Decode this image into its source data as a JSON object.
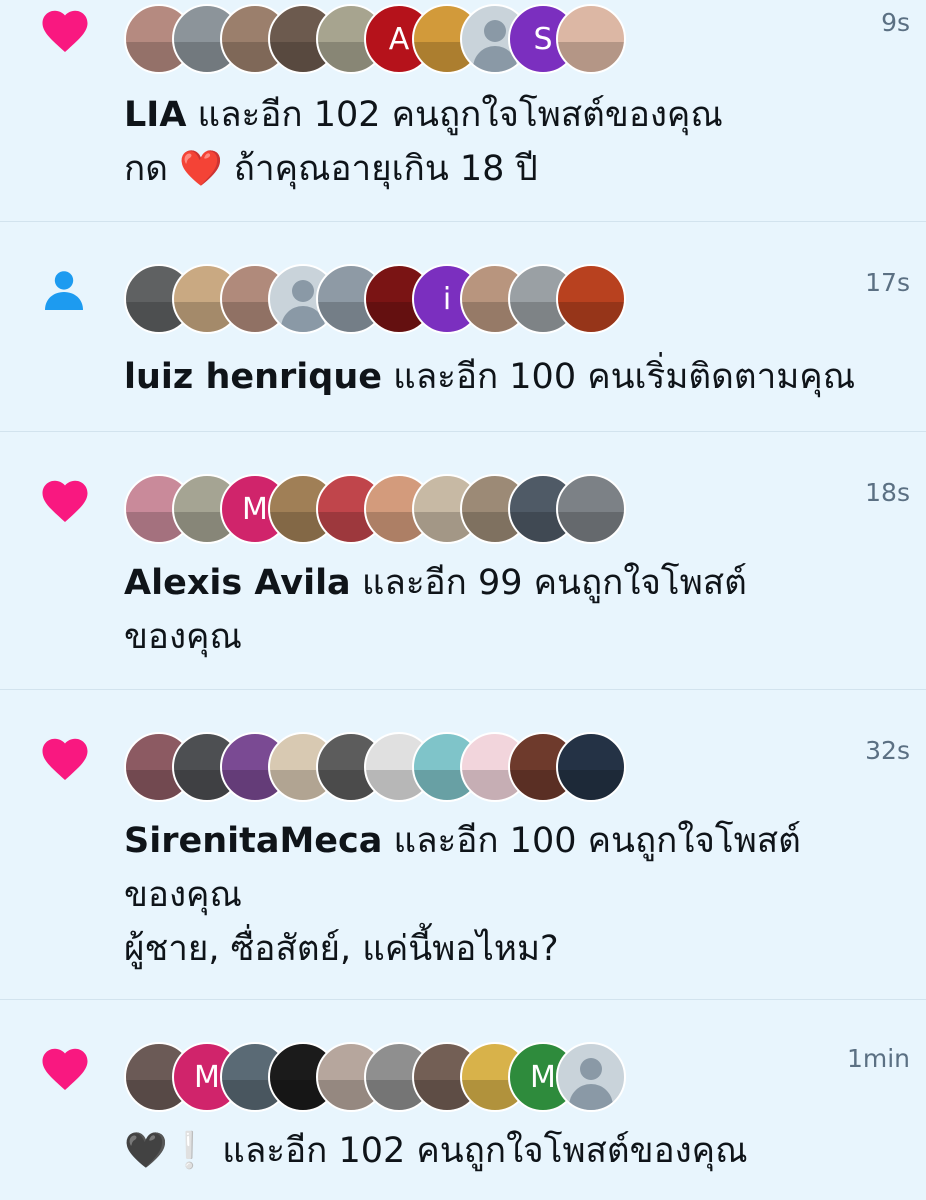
{
  "colors": {
    "background": "#e8f5fd",
    "like_pink": "#f91880",
    "follow_blue": "#1d9bf0",
    "divider": "#d2e3ee",
    "time_gray": "#5b7083"
  },
  "notifications": [
    {
      "type": "like",
      "icon": "heart-icon",
      "time": "9s",
      "name": "LIA",
      "action": " และอีก 102 คนถูกใจโพสต์ของคุณ",
      "extra_lines": [
        "กด ❤️ ถ้าคุณอายุเกิน 18 ปี"
      ],
      "avatars": [
        {
          "kind": "photo",
          "color": "#b58a80"
        },
        {
          "kind": "photo",
          "color": "#8c949a"
        },
        {
          "kind": "photo",
          "color": "#9b7f6c"
        },
        {
          "kind": "photo",
          "color": "#6c5a4e"
        },
        {
          "kind": "photo",
          "color": "#a7a48f"
        },
        {
          "kind": "letter",
          "letter": "A",
          "color": "#b5121b"
        },
        {
          "kind": "photo",
          "color": "#d29a3a"
        },
        {
          "kind": "default"
        },
        {
          "kind": "letter",
          "letter": "S",
          "color": "#7b2fbf"
        },
        {
          "kind": "photo",
          "color": "#dcb7a4"
        }
      ]
    },
    {
      "type": "follow",
      "icon": "person-icon",
      "time": "17s",
      "name": "luiz henrique",
      "action": " และอีก 100 คนเริ่มติดตามคุณ",
      "extra_lines": [],
      "avatars": [
        {
          "kind": "photo",
          "color": "#5f6162"
        },
        {
          "kind": "photo",
          "color": "#c9a982"
        },
        {
          "kind": "photo",
          "color": "#b08a7b"
        },
        {
          "kind": "default"
        },
        {
          "kind": "photo",
          "color": "#8e9aa5"
        },
        {
          "kind": "photo",
          "color": "#7a1414"
        },
        {
          "kind": "letter",
          "letter": "i",
          "color": "#7b2fbf"
        },
        {
          "kind": "photo",
          "color": "#b8957e"
        },
        {
          "kind": "photo",
          "color": "#9aa0a4"
        },
        {
          "kind": "photo",
          "color": "#b8411f"
        }
      ]
    },
    {
      "type": "like",
      "icon": "heart-icon",
      "time": "18s",
      "name": "Alexis Avila",
      "action": " และอีก 99 คนถูกใจโพสต์ของคุณ",
      "extra_lines": [],
      "avatars": [
        {
          "kind": "photo",
          "color": "#c98a9a"
        },
        {
          "kind": "photo",
          "color": "#a5a493"
        },
        {
          "kind": "letter",
          "letter": "M",
          "color": "#d0246b"
        },
        {
          "kind": "photo",
          "color": "#a07f56"
        },
        {
          "kind": "photo",
          "color": "#c0454b"
        },
        {
          "kind": "photo",
          "color": "#d39b7c"
        },
        {
          "kind": "photo",
          "color": "#c7b9a4"
        },
        {
          "kind": "photo",
          "color": "#9c8a76"
        },
        {
          "kind": "photo",
          "color": "#4f5a66"
        },
        {
          "kind": "photo",
          "color": "#7c8186"
        }
      ]
    },
    {
      "type": "like",
      "icon": "heart-icon",
      "time": "32s",
      "name": "SirenitaMeca",
      "action": " และอีก 100 คนถูกใจโพสต์ของคุณ",
      "extra_lines": [
        "ผู้ชาย, ซื่อสัตย์, แค่นี้พอไหม?"
      ],
      "avatars": [
        {
          "kind": "photo",
          "color": "#8c5a62"
        },
        {
          "kind": "photo",
          "color": "#4d4f52"
        },
        {
          "kind": "photo",
          "color": "#7a4a93"
        },
        {
          "kind": "photo",
          "color": "#d8c9b2"
        },
        {
          "kind": "photo",
          "color": "#5c5c5c"
        },
        {
          "kind": "photo",
          "color": "#e0e0e0"
        },
        {
          "kind": "photo",
          "color": "#7fc4c9"
        },
        {
          "kind": "photo",
          "color": "#f2d5dc"
        },
        {
          "kind": "photo",
          "color": "#6e3a2c"
        },
        {
          "kind": "photo",
          "color": "#243245"
        }
      ]
    },
    {
      "type": "like",
      "icon": "heart-icon",
      "time": "1min",
      "name": "🖤❕",
      "action": " และอีก 102 คนถูกใจโพสต์ของคุณ",
      "extra_lines": [],
      "avatars": [
        {
          "kind": "photo",
          "color": "#6b5a56"
        },
        {
          "kind": "letter",
          "letter": "M",
          "color": "#d0246b"
        },
        {
          "kind": "photo",
          "color": "#5a6a75"
        },
        {
          "kind": "photo",
          "color": "#1b1b1b"
        },
        {
          "kind": "photo",
          "color": "#b6a69d"
        },
        {
          "kind": "photo",
          "color": "#8f8f8f"
        },
        {
          "kind": "photo",
          "color": "#735f55"
        },
        {
          "kind": "photo",
          "color": "#d8b24a"
        },
        {
          "kind": "letter",
          "letter": "M",
          "color": "#2e8b3c"
        },
        {
          "kind": "default"
        }
      ]
    }
  ]
}
